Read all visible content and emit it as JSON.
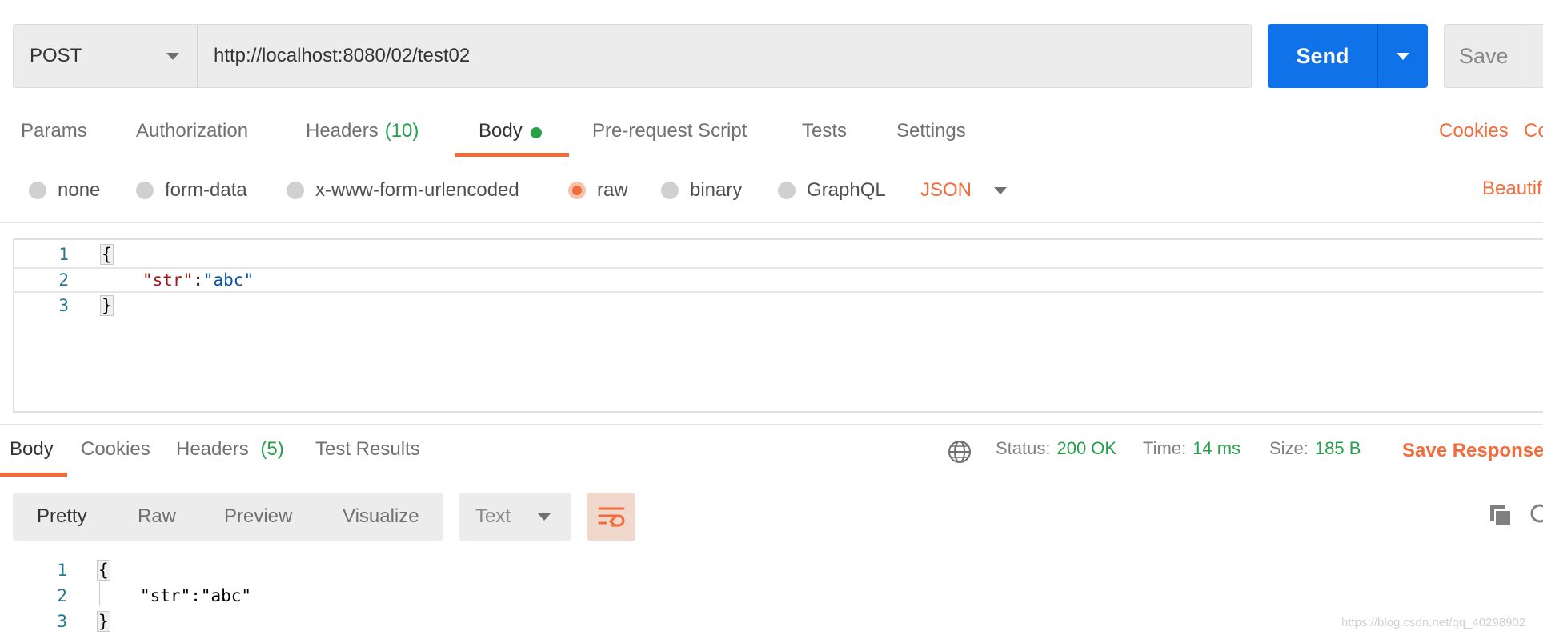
{
  "request": {
    "method": "POST",
    "url": "http://localhost:8080/02/test02",
    "send_label": "Send",
    "save_label": "Save"
  },
  "request_tabs": [
    {
      "label": "Params"
    },
    {
      "label": "Authorization"
    },
    {
      "label": "Headers",
      "count": "(10)"
    },
    {
      "label": "Body",
      "active": true
    },
    {
      "label": "Pre-request Script"
    },
    {
      "label": "Tests"
    },
    {
      "label": "Settings"
    }
  ],
  "links": {
    "cookies": "Cookies",
    "code": "Co",
    "beautify": "Beautif"
  },
  "body_types": [
    {
      "label": "none",
      "selected": false
    },
    {
      "label": "form-data",
      "selected": false
    },
    {
      "label": "x-www-form-urlencoded",
      "selected": false
    },
    {
      "label": "raw",
      "selected": true
    },
    {
      "label": "binary",
      "selected": false
    },
    {
      "label": "GraphQL",
      "selected": false
    }
  ],
  "format": "JSON",
  "request_body": {
    "lines": [
      {
        "n": "1",
        "open": "{"
      },
      {
        "n": "2",
        "key": "\"str\"",
        "colon": ":",
        "value": "\"abc\""
      },
      {
        "n": "3",
        "close": "}"
      }
    ]
  },
  "response_tabs": [
    {
      "label": "Body",
      "active": true
    },
    {
      "label": "Cookies"
    },
    {
      "label": "Headers",
      "count": "(5)"
    },
    {
      "label": "Test Results"
    }
  ],
  "response_status": {
    "status_label": "Status:",
    "status_value": "200 OK",
    "time_label": "Time:",
    "time_value": "14 ms",
    "size_label": "Size:",
    "size_value": "185 B",
    "save_response": "Save Response"
  },
  "view_modes": [
    "Pretty",
    "Raw",
    "Preview",
    "Visualize"
  ],
  "text_format": "Text",
  "response_body": {
    "lines": [
      {
        "n": "1",
        "open": "{"
      },
      {
        "n": "2",
        "text": "\"str\":\"abc\""
      },
      {
        "n": "3",
        "close": "}"
      }
    ]
  },
  "watermark": "https://blog.csdn.net/qq_40298902",
  "colors": {
    "accent": "#f26b3a",
    "primary": "#0f72e8",
    "success": "#26a04a"
  }
}
